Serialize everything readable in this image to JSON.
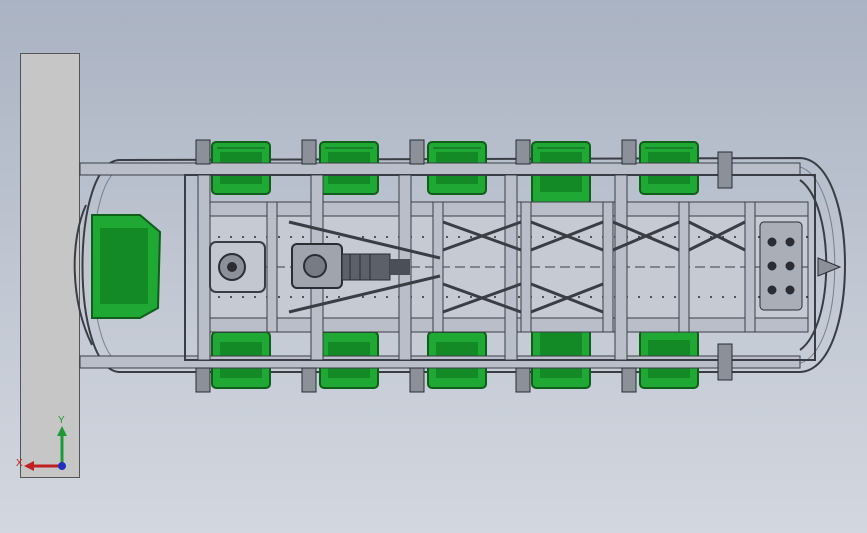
{
  "view": {
    "background_top": "#aab3c3",
    "background_bottom": "#d3d7df",
    "part_colors": {
      "frame": "#b9bec8",
      "frame_edge": "#3a3d44",
      "seat_green": "#1fa833",
      "seat_dark": "#0f5e1a",
      "wall": "#c6c6c6"
    },
    "seat_columns": 5,
    "seat_rows_per_column": 2
  },
  "triad": {
    "x_label": "X",
    "y_label": "Y",
    "x_color": "#c02020",
    "y_color": "#1d9a35",
    "z_color": "#2030c0"
  }
}
